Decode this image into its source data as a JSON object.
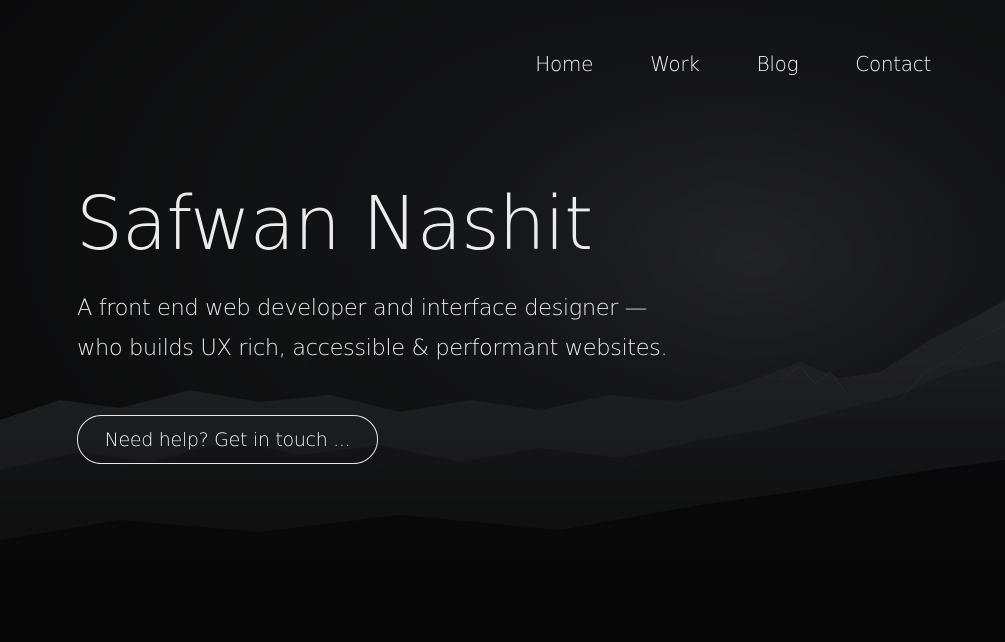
{
  "nav": {
    "items": [
      {
        "label": "Home"
      },
      {
        "label": "Work"
      },
      {
        "label": "Blog"
      },
      {
        "label": "Contact"
      }
    ]
  },
  "hero": {
    "title": "Safwan Nashit",
    "subtitle_line1": "A front end web developer and interface designer —",
    "subtitle_line2": "who builds UX rich, accessible & performant websites.",
    "cta_label": "Need help? Get in touch ..."
  },
  "colors": {
    "background": "#0c0c0d",
    "text": "#ececec",
    "button_border": "#e8e8e8"
  }
}
